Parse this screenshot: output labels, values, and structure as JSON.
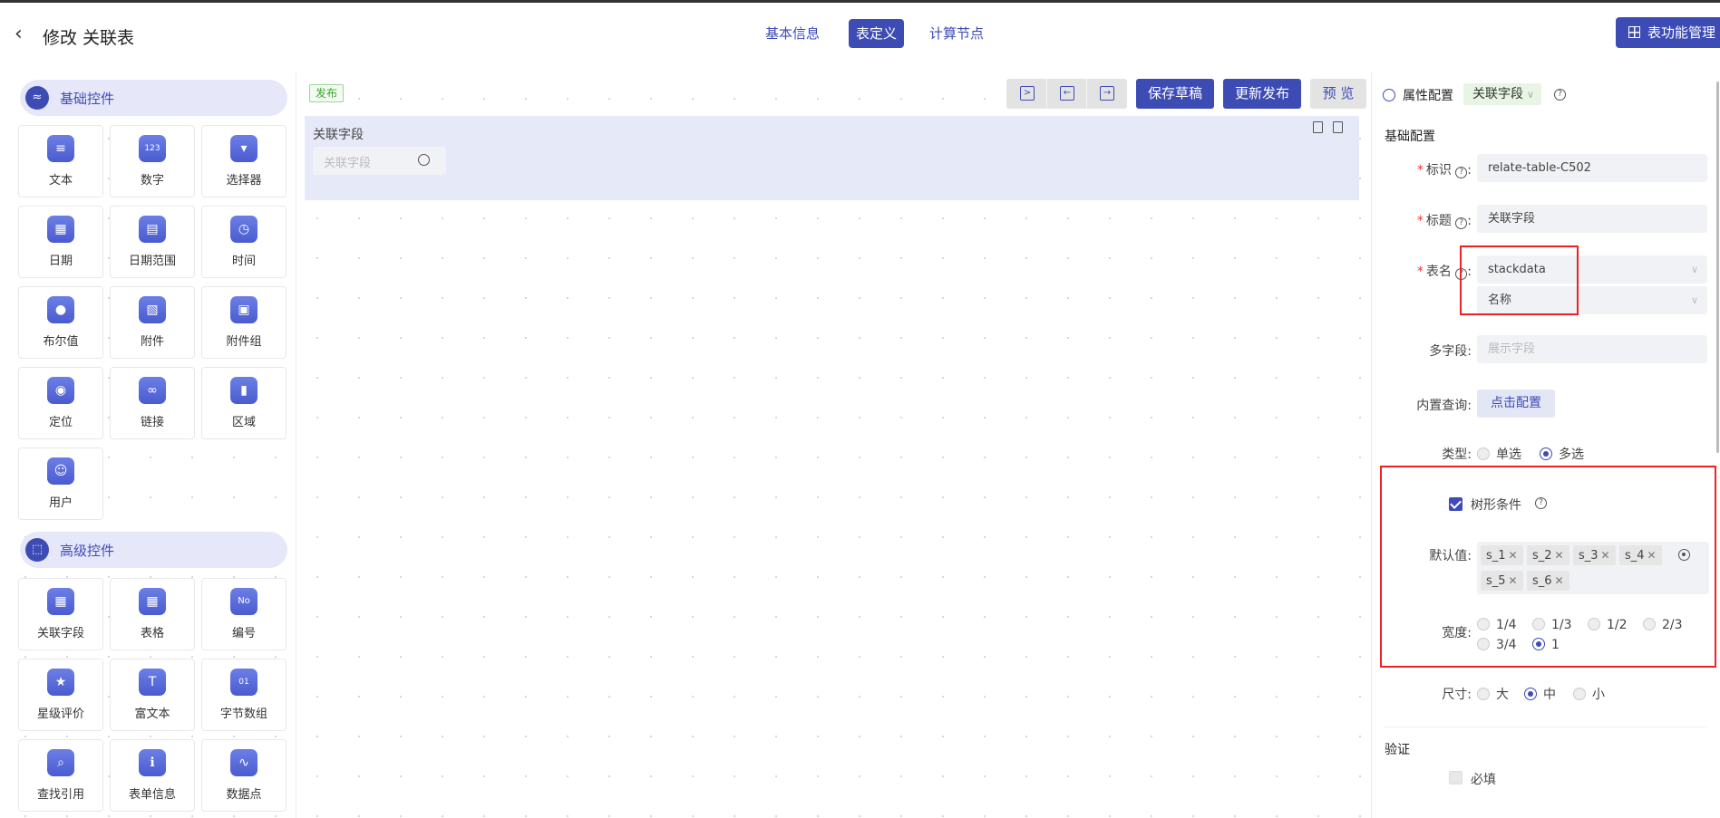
{
  "header": {
    "back_icon": "chevron-left-icon",
    "title": "修改 关联表",
    "nav": [
      "基本信息",
      "表定义",
      "计算节点"
    ],
    "active_nav": "表定义",
    "function_button": "表功能管理"
  },
  "palette": {
    "basic_group": "基础控件",
    "basic_items": [
      "文本",
      "数字",
      "选择器",
      "日期",
      "日期范围",
      "时间",
      "布尔值",
      "附件",
      "附件组",
      "定位",
      "链接",
      "区域",
      "用户"
    ],
    "advanced_group": "高级控件",
    "advanced_items": [
      "关联字段",
      "表格",
      "编号",
      "星级评价",
      "富文本",
      "字节数组",
      "查找引用",
      "表单信息",
      "数据点"
    ]
  },
  "canvas": {
    "status_tag": "发布",
    "save_draft": "保存草稿",
    "update_publish": "更新发布",
    "preview": "预 览",
    "field_label": "关联字段",
    "field_placeholder": "关联字段"
  },
  "props": {
    "panel_title": "属性配置",
    "field_type": "关联字段",
    "section_basic": "基础配置",
    "id_label": "标识",
    "id_value": "relate-table-C502",
    "title_label": "标题",
    "title_value": "关联字段",
    "table_label": "表名",
    "table_value": "stackdata",
    "table_field_value": "名称",
    "multi_label": "多字段:",
    "multi_placeholder": "展示字段",
    "query_label": "内置查询:",
    "query_button": "点击配置",
    "type_label": "类型:",
    "type_options": [
      "单选",
      "多选"
    ],
    "type_selected": "多选",
    "tree_label": "树形条件",
    "tree_checked": true,
    "default_label": "默认值:",
    "default_values": [
      "s_1",
      "s_2",
      "s_3",
      "s_4",
      "s_5",
      "s_6"
    ],
    "width_label": "宽度:",
    "width_options": [
      "1/4",
      "1/3",
      "1/2",
      "2/3",
      "3/4",
      "1"
    ],
    "width_selected": "1",
    "size_label": "尺寸:",
    "size_options": [
      "大",
      "中",
      "小"
    ],
    "size_selected": "中",
    "section_validate": "验证",
    "required_label": "必填",
    "required_checked": false
  },
  "colors": {
    "accent": "#3d4bb5",
    "highlight_box": "#e22222",
    "publish_tag": "#3da233"
  }
}
